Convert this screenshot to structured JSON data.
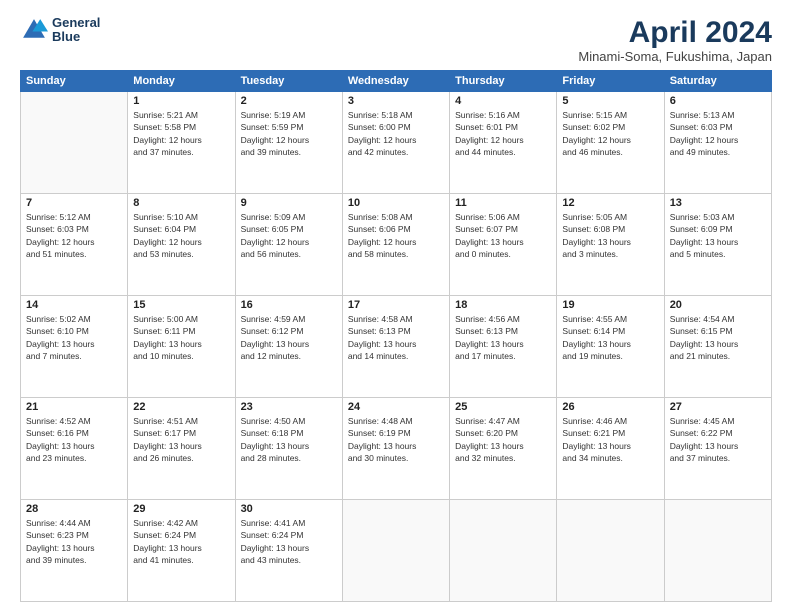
{
  "logo": {
    "line1": "General",
    "line2": "Blue"
  },
  "title": "April 2024",
  "subtitle": "Minami-Soma, Fukushima, Japan",
  "days_of_week": [
    "Sunday",
    "Monday",
    "Tuesday",
    "Wednesday",
    "Thursday",
    "Friday",
    "Saturday"
  ],
  "weeks": [
    [
      {
        "day": "",
        "info": ""
      },
      {
        "day": "1",
        "info": "Sunrise: 5:21 AM\nSunset: 5:58 PM\nDaylight: 12 hours\nand 37 minutes."
      },
      {
        "day": "2",
        "info": "Sunrise: 5:19 AM\nSunset: 5:59 PM\nDaylight: 12 hours\nand 39 minutes."
      },
      {
        "day": "3",
        "info": "Sunrise: 5:18 AM\nSunset: 6:00 PM\nDaylight: 12 hours\nand 42 minutes."
      },
      {
        "day": "4",
        "info": "Sunrise: 5:16 AM\nSunset: 6:01 PM\nDaylight: 12 hours\nand 44 minutes."
      },
      {
        "day": "5",
        "info": "Sunrise: 5:15 AM\nSunset: 6:02 PM\nDaylight: 12 hours\nand 46 minutes."
      },
      {
        "day": "6",
        "info": "Sunrise: 5:13 AM\nSunset: 6:03 PM\nDaylight: 12 hours\nand 49 minutes."
      }
    ],
    [
      {
        "day": "7",
        "info": "Sunrise: 5:12 AM\nSunset: 6:03 PM\nDaylight: 12 hours\nand 51 minutes."
      },
      {
        "day": "8",
        "info": "Sunrise: 5:10 AM\nSunset: 6:04 PM\nDaylight: 12 hours\nand 53 minutes."
      },
      {
        "day": "9",
        "info": "Sunrise: 5:09 AM\nSunset: 6:05 PM\nDaylight: 12 hours\nand 56 minutes."
      },
      {
        "day": "10",
        "info": "Sunrise: 5:08 AM\nSunset: 6:06 PM\nDaylight: 12 hours\nand 58 minutes."
      },
      {
        "day": "11",
        "info": "Sunrise: 5:06 AM\nSunset: 6:07 PM\nDaylight: 13 hours\nand 0 minutes."
      },
      {
        "day": "12",
        "info": "Sunrise: 5:05 AM\nSunset: 6:08 PM\nDaylight: 13 hours\nand 3 minutes."
      },
      {
        "day": "13",
        "info": "Sunrise: 5:03 AM\nSunset: 6:09 PM\nDaylight: 13 hours\nand 5 minutes."
      }
    ],
    [
      {
        "day": "14",
        "info": "Sunrise: 5:02 AM\nSunset: 6:10 PM\nDaylight: 13 hours\nand 7 minutes."
      },
      {
        "day": "15",
        "info": "Sunrise: 5:00 AM\nSunset: 6:11 PM\nDaylight: 13 hours\nand 10 minutes."
      },
      {
        "day": "16",
        "info": "Sunrise: 4:59 AM\nSunset: 6:12 PM\nDaylight: 13 hours\nand 12 minutes."
      },
      {
        "day": "17",
        "info": "Sunrise: 4:58 AM\nSunset: 6:13 PM\nDaylight: 13 hours\nand 14 minutes."
      },
      {
        "day": "18",
        "info": "Sunrise: 4:56 AM\nSunset: 6:13 PM\nDaylight: 13 hours\nand 17 minutes."
      },
      {
        "day": "19",
        "info": "Sunrise: 4:55 AM\nSunset: 6:14 PM\nDaylight: 13 hours\nand 19 minutes."
      },
      {
        "day": "20",
        "info": "Sunrise: 4:54 AM\nSunset: 6:15 PM\nDaylight: 13 hours\nand 21 minutes."
      }
    ],
    [
      {
        "day": "21",
        "info": "Sunrise: 4:52 AM\nSunset: 6:16 PM\nDaylight: 13 hours\nand 23 minutes."
      },
      {
        "day": "22",
        "info": "Sunrise: 4:51 AM\nSunset: 6:17 PM\nDaylight: 13 hours\nand 26 minutes."
      },
      {
        "day": "23",
        "info": "Sunrise: 4:50 AM\nSunset: 6:18 PM\nDaylight: 13 hours\nand 28 minutes."
      },
      {
        "day": "24",
        "info": "Sunrise: 4:48 AM\nSunset: 6:19 PM\nDaylight: 13 hours\nand 30 minutes."
      },
      {
        "day": "25",
        "info": "Sunrise: 4:47 AM\nSunset: 6:20 PM\nDaylight: 13 hours\nand 32 minutes."
      },
      {
        "day": "26",
        "info": "Sunrise: 4:46 AM\nSunset: 6:21 PM\nDaylight: 13 hours\nand 34 minutes."
      },
      {
        "day": "27",
        "info": "Sunrise: 4:45 AM\nSunset: 6:22 PM\nDaylight: 13 hours\nand 37 minutes."
      }
    ],
    [
      {
        "day": "28",
        "info": "Sunrise: 4:44 AM\nSunset: 6:23 PM\nDaylight: 13 hours\nand 39 minutes."
      },
      {
        "day": "29",
        "info": "Sunrise: 4:42 AM\nSunset: 6:24 PM\nDaylight: 13 hours\nand 41 minutes."
      },
      {
        "day": "30",
        "info": "Sunrise: 4:41 AM\nSunset: 6:24 PM\nDaylight: 13 hours\nand 43 minutes."
      },
      {
        "day": "",
        "info": ""
      },
      {
        "day": "",
        "info": ""
      },
      {
        "day": "",
        "info": ""
      },
      {
        "day": "",
        "info": ""
      }
    ]
  ]
}
